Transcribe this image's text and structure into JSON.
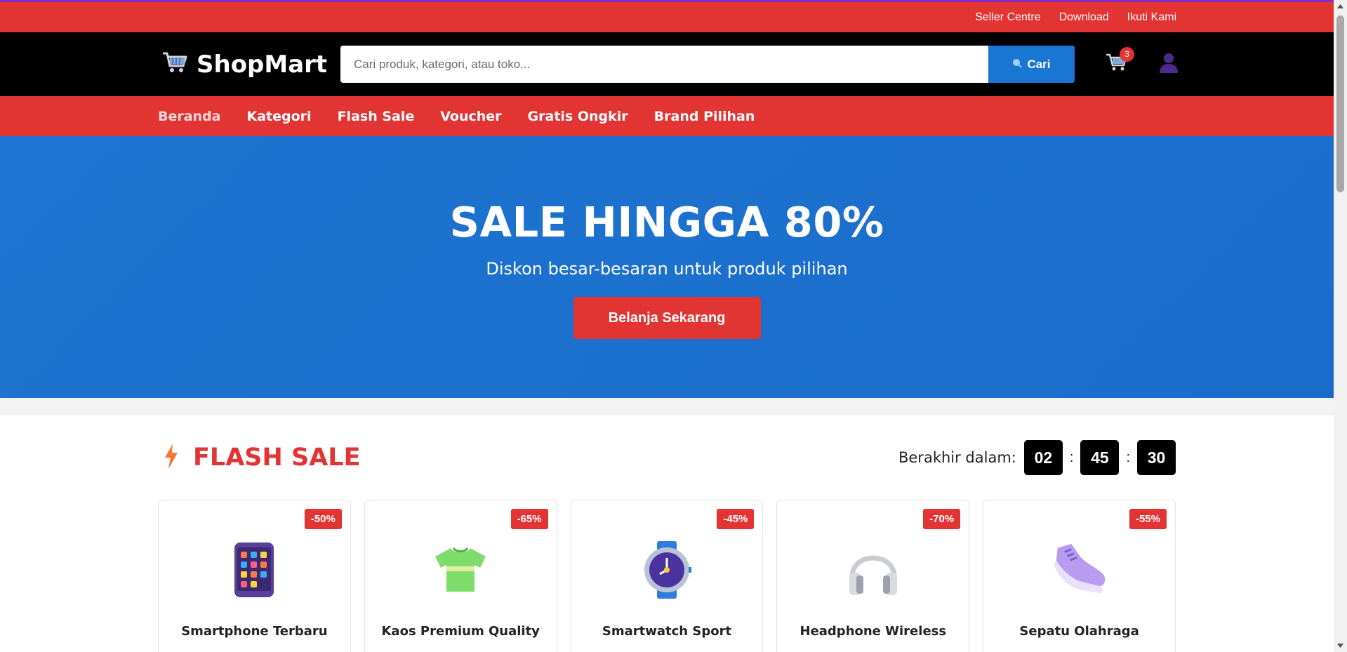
{
  "topbar": {
    "links": [
      "Seller Centre",
      "Download",
      "Ikuti Kami"
    ]
  },
  "header": {
    "logo_text": "ShopMart",
    "logo_icon": "cart-icon",
    "search_placeholder": "Cari produk, kategori, atau toko...",
    "search_button": "Cari",
    "cart_count": "3"
  },
  "nav": {
    "items": [
      "Beranda",
      "Kategori",
      "Flash Sale",
      "Voucher",
      "Gratis Ongkir",
      "Brand Pilihan"
    ]
  },
  "hero": {
    "title": "SALE HINGGA 80%",
    "subtitle": "Diskon besar-besaran untuk produk pilihan",
    "cta": "Belanja Sekarang"
  },
  "flash_sale": {
    "title": "FLASH SALE",
    "ends_label": "Berakhir dalam:",
    "timer": {
      "hours": "02",
      "minutes": "45",
      "seconds": "30"
    },
    "products": [
      {
        "name": "Smartphone Terbaru",
        "discount": "-50%",
        "icon": "smartphone-icon"
      },
      {
        "name": "Kaos Premium Quality",
        "discount": "-65%",
        "icon": "tshirt-icon"
      },
      {
        "name": "Smartwatch Sport",
        "discount": "-45%",
        "icon": "watch-icon"
      },
      {
        "name": "Headphone Wireless",
        "discount": "-70%",
        "icon": "headphones-icon"
      },
      {
        "name": "Sepatu Olahraga",
        "discount": "-55%",
        "icon": "sneaker-icon"
      }
    ]
  },
  "colors": {
    "primary_red": "#e33434",
    "primary_blue": "#1976d2",
    "header_bg": "#000000"
  }
}
